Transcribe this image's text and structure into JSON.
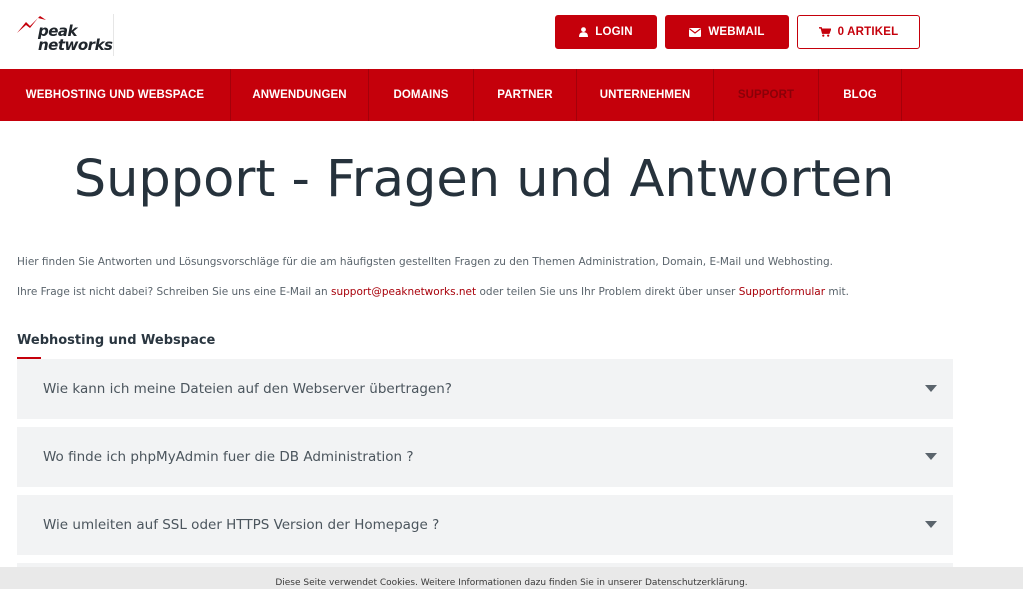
{
  "brand": {
    "name_line1": "peak",
    "name_line2": "networks",
    "accent_color": "#c5000b"
  },
  "header": {
    "login_label": "LOGIN",
    "login_icon": "user-icon",
    "webmail_label": "WEBMAIL",
    "webmail_icon": "envelope-icon",
    "cart_label": "0 ARTIKEL",
    "cart_icon": "shopping-cart-icon"
  },
  "nav": {
    "items": [
      {
        "label": "WEBHOSTING UND WEBSPACE"
      },
      {
        "label": "ANWENDUNGEN"
      },
      {
        "label": "DOMAINS"
      },
      {
        "label": "PARTNER"
      },
      {
        "label": "UNTERNEHMEN"
      },
      {
        "label": "SUPPORT",
        "active": true
      },
      {
        "label": "BLOG"
      }
    ]
  },
  "main": {
    "title": "Support - Fragen und Antworten",
    "intro1": "Hier finden Sie Antworten und Lösungsvorschläge für die am häufigsten gestellten Fragen zu den Themen Administration, Domain, E-Mail und Webhosting.",
    "intro2_before": "Ihre Frage ist nicht dabei? Schreiben Sie uns eine E-Mail an ",
    "intro2_email": "support@peaknetworks.net",
    "intro2_middle": " oder teilen Sie uns Ihr Problem direkt über unser ",
    "intro2_link": "Supportformular",
    "intro2_after": " mit.",
    "section_heading": "Webhosting und Webspace",
    "faqs": [
      {
        "question": "Wie kann ich meine Dateien auf den Webserver übertragen?"
      },
      {
        "question": "Wo finde ich phpMyAdmin fuer die DB Administration ?"
      },
      {
        "question": "Wie umleiten auf SSL oder HTTPS Version der Homepage ?"
      },
      {
        "question": ""
      }
    ]
  },
  "cookie_banner": {
    "text": "Diese Seite verwendet Cookies. Weitere Informationen dazu finden Sie in unserer Datenschutzerklärung."
  }
}
